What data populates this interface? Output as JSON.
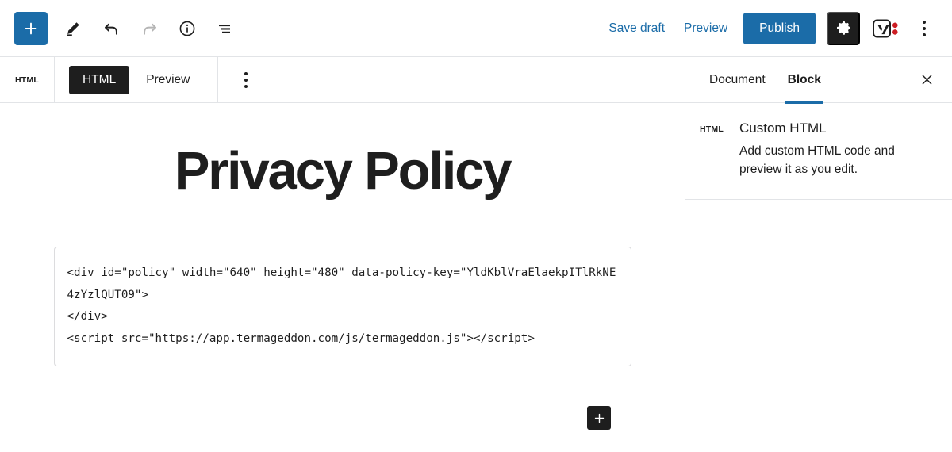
{
  "topbar": {
    "inserter_label": "Add block",
    "inserter_icon": "plus-icon",
    "tools": [
      {
        "name": "edit-tool",
        "icon": "pencil-icon",
        "enabled": true
      },
      {
        "name": "undo",
        "icon": "undo-arrow-icon",
        "enabled": true
      },
      {
        "name": "redo",
        "icon": "redo-arrow-icon",
        "enabled": false
      },
      {
        "name": "details",
        "icon": "info-circle-icon",
        "enabled": true
      },
      {
        "name": "list-view",
        "icon": "list-view-icon",
        "enabled": true
      }
    ],
    "save_draft_label": "Save draft",
    "preview_label": "Preview",
    "publish_label": "Publish",
    "settings_icon": "gear-icon",
    "yoast_icon": "yoast-seo-icon",
    "more_icon": "kebab-menu-icon",
    "accent_color": "#1b6ca8",
    "dark_color": "#1e1e1e",
    "yoast_dot_color": "#cc1d23"
  },
  "block_toolbar": {
    "block_icon_label": "HTML",
    "tabs": [
      {
        "label": "HTML",
        "active": true
      },
      {
        "label": "Preview",
        "active": false
      }
    ],
    "more_options_icon": "kebab-menu-icon"
  },
  "canvas": {
    "post_title": "Privacy Policy",
    "code": {
      "line1_a": "<div id=\"policy\" width=\"640\" height=\"480\" data-policy-",
      "line2_pre": "key=\"",
      "line2_key": "YldKblVraElaekpITlRkNE4zYzlQUT09",
      "line2_post": "\">",
      "line3": "</div>",
      "line4": "<script src=\"https://app.termageddon.com/js/termageddon.js\"></script>"
    },
    "add_block_icon": "plus-icon"
  },
  "sidebar": {
    "tabs": [
      {
        "label": "Document",
        "active": false
      },
      {
        "label": "Block",
        "active": true
      }
    ],
    "close_icon": "close-x-icon",
    "block": {
      "icon_label": "HTML",
      "title": "Custom HTML",
      "description": "Add custom HTML code and preview it as you edit."
    }
  }
}
